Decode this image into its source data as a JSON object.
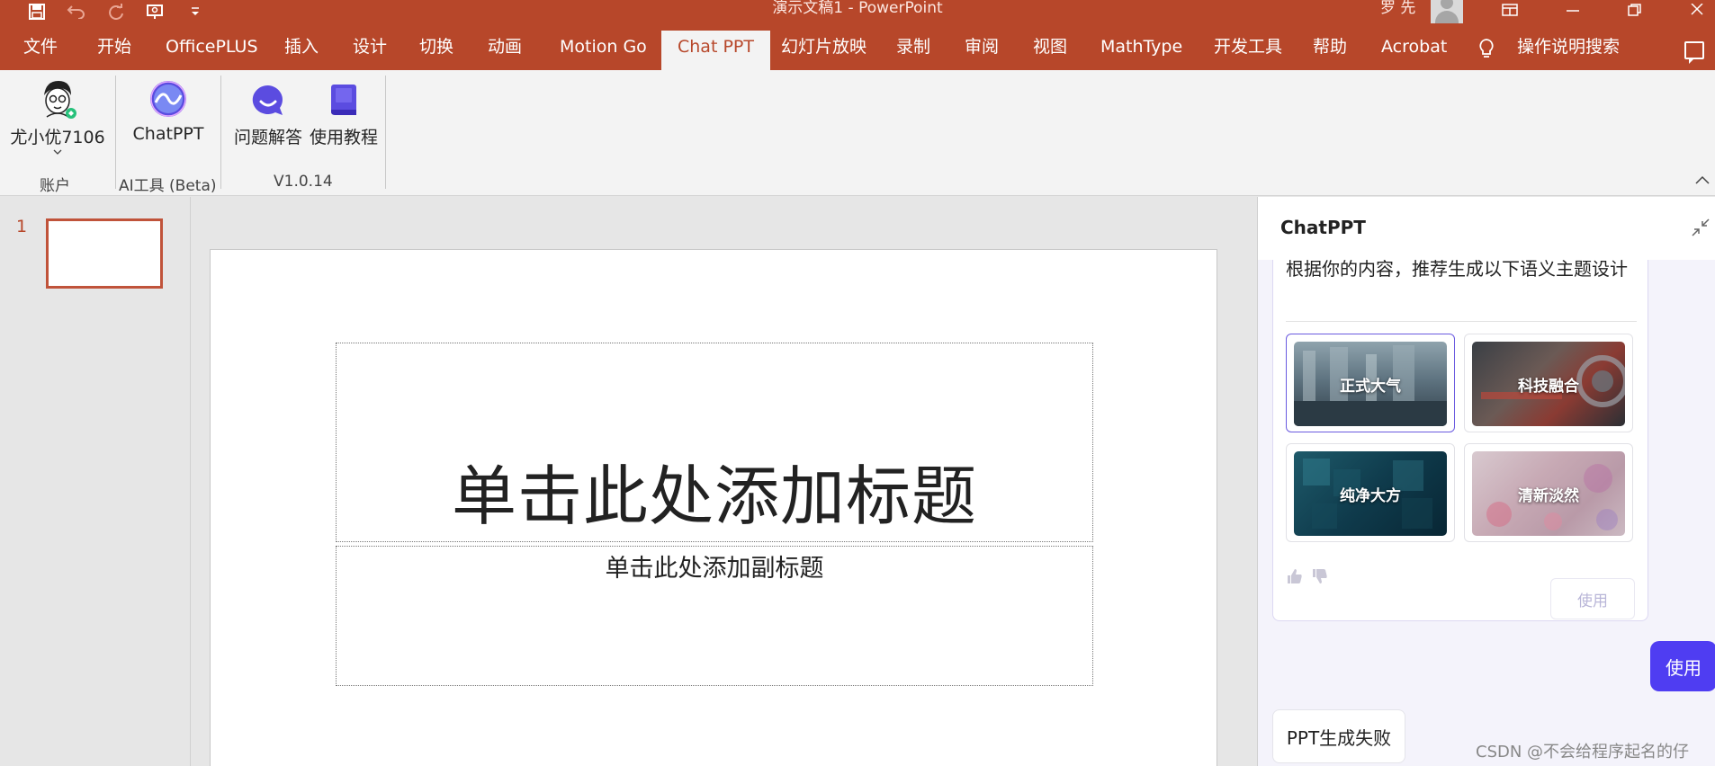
{
  "window": {
    "title": "演示文稿1  -  PowerPoint",
    "user_name": "罗 先",
    "controls": [
      "ribbon-display-icon",
      "minimize-icon",
      "restore-icon",
      "close-icon"
    ]
  },
  "qat": [
    "save-icon",
    "undo-icon",
    "redo-icon",
    "present-icon",
    "customize-icon"
  ],
  "tabs": [
    {
      "label": "文件"
    },
    {
      "label": "开始"
    },
    {
      "label": "OfficePLUS"
    },
    {
      "label": "插入"
    },
    {
      "label": "设计"
    },
    {
      "label": "切换"
    },
    {
      "label": "动画"
    },
    {
      "label": "Motion Go"
    },
    {
      "label": "Chat PPT",
      "active": true
    },
    {
      "label": "幻灯片放映"
    },
    {
      "label": "录制"
    },
    {
      "label": "审阅"
    },
    {
      "label": "视图"
    },
    {
      "label": "MathType"
    },
    {
      "label": "开发工具"
    },
    {
      "label": "帮助"
    },
    {
      "label": "Acrobat"
    },
    {
      "label": "操作说明搜索"
    }
  ],
  "ribbon": {
    "account": {
      "label": "尤小优7106",
      "group": "账户"
    },
    "chatppt": {
      "label": "ChatPPT",
      "group": "AI工具 (Beta)"
    },
    "qa": {
      "label": "问题解答"
    },
    "tutorial": {
      "label": "使用教程"
    },
    "version_group": "V1.0.14"
  },
  "thumbnails": [
    {
      "number": "1"
    }
  ],
  "slide": {
    "title_placeholder": "单击此处添加标题",
    "subtitle_placeholder": "单击此处添加副标题"
  },
  "panel": {
    "title": "ChatPPT",
    "message": "根据你的内容，推荐生成以下语义主题设计",
    "themes": [
      {
        "label": "正式大气",
        "selected": true
      },
      {
        "label": "科技融合"
      },
      {
        "label": "纯净大方"
      },
      {
        "label": "清新淡然"
      }
    ],
    "card_use_label": "使用",
    "use_label": "使用",
    "failure_text": "PPT生成失败"
  },
  "watermark": "CSDN @不会给程序起名的仔",
  "colors": {
    "accent": "#b7472a",
    "panel_accent": "#4f3df2",
    "selection": "#6a5ae0"
  }
}
